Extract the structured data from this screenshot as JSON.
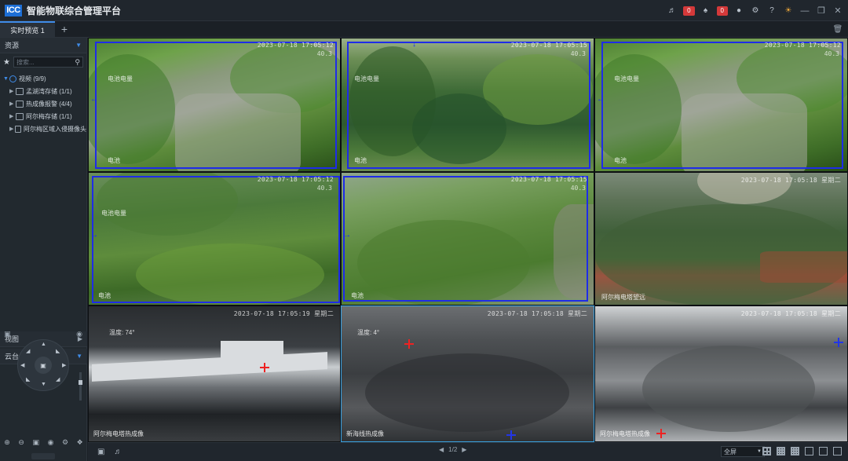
{
  "app": {
    "logo": "ICC",
    "title": "智能物联综合管理平台",
    "notifications": [
      {
        "icon": "volume-icon",
        "count": "0"
      },
      {
        "icon": "bell-icon",
        "count": "0"
      }
    ]
  },
  "tabs": [
    {
      "label": "实时预览 1",
      "active": true
    }
  ],
  "sidebar": {
    "resource_title": "资源",
    "search_placeholder": "搜索...",
    "tree": {
      "root": "视频 (9/9)",
      "children": [
        {
          "label": "孟湖湾存储 (1/1)"
        },
        {
          "label": "热成像报警 (4/4)"
        },
        {
          "label": "阿尔梅存储 (1/1)"
        },
        {
          "label": "阿尔梅区域入侵摄像头"
        }
      ]
    },
    "view_title": "视图",
    "ptz_title": "云台"
  },
  "cells": [
    {
      "time": "2023-07-18 17:05:12",
      "sub": "40.3",
      "label": "电池电量",
      "bottom": "电池"
    },
    {
      "time": "2023-07-18 17:05:15",
      "sub": "40.3",
      "label": "电池电量",
      "bottom": "电池"
    },
    {
      "time": "2023-07-18 17:05:12",
      "sub": "40.3",
      "label": "电池电量",
      "bottom": "电池"
    },
    {
      "time": "2023-07-18 17:05:12",
      "sub": "40.3",
      "label": "电池电量",
      "bottom": "电池"
    },
    {
      "time": "2023-07-18 17:05:15",
      "sub": "40.3",
      "label": "",
      "bottom": "电池"
    },
    {
      "time": "2023-07-18 17:05:18 星期二",
      "sub": "",
      "label": "",
      "bottom": "阿尔梅电塔望远"
    },
    {
      "time": "2023-07-18 17:05:19 星期二",
      "sub": "",
      "label": "温度: 74°",
      "bottom": "阿尔梅电塔热成像"
    },
    {
      "time": "2023-07-18 17:05:18 星期二",
      "sub": "",
      "label": "温度: 4°",
      "bottom": "新海线热成像"
    },
    {
      "time": "2023-07-18 17:05:18 星期二",
      "sub": "",
      "label": "",
      "bottom": "阿尔梅电塔热成像"
    }
  ],
  "bottom": {
    "pager": "1/2",
    "layout_select": "全屏"
  }
}
